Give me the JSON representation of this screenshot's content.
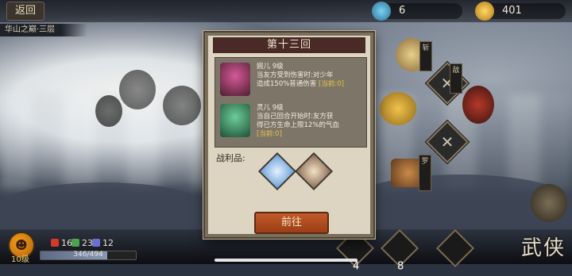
{
  "top": {
    "back_label": "返回",
    "stage_name": "华山之巅·三层",
    "res_a": "6",
    "res_b": "401"
  },
  "right_tags": [
    "斩",
    "罗",
    "敌"
  ],
  "dialog": {
    "title": "第十三回",
    "enemies": [
      {
        "header": "婉儿 9级",
        "line1": "当友方受到伤害时:对少年",
        "line2": "造成150%普通伤害",
        "current": "[当前:0]",
        "icon": "hat-girl-portrait-icon"
      },
      {
        "header": "灵儿 9级",
        "line1": "当自己回合开始时:友方获",
        "line2": "得已方生命上限12%的气血",
        "current": "[当前:0]",
        "icon": "green-hair-girl-portrait-icon"
      }
    ],
    "loot_label": "战利品:",
    "button": "前往"
  },
  "player": {
    "level": "10级",
    "hp_text": "346/494",
    "hp_fraction": 0.7,
    "counters": [
      "16",
      "23",
      "12"
    ]
  },
  "skills": [
    "4",
    "8"
  ],
  "brand": "武侠"
}
